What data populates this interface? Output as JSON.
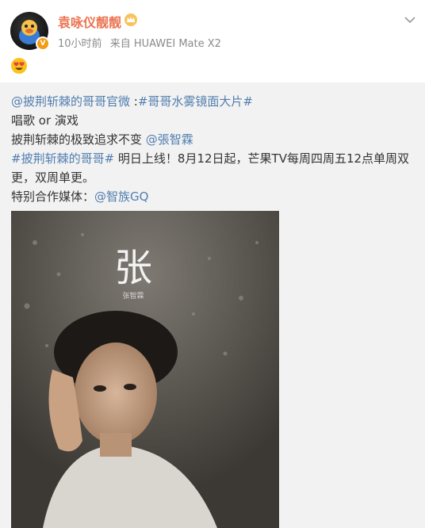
{
  "header": {
    "username": "袁咏仪靓靓",
    "time": "10小时前",
    "source": "来自 HUAWEI Mate X2"
  },
  "post": {
    "line1_mention": "@披荆斩棘的哥哥官微",
    "line1_sep": " :",
    "line1_tag": "#哥哥水雾镜面大片#",
    "line2": "唱歌 or 演戏",
    "line3_text": "披荆斩棘的极致追求不变 ",
    "line3_mention": "@張智霖",
    "line4_tag": "#披荆斩棘的哥哥#",
    "line4_text": " 明日上线！8月12日起，芒果TV每周四周五12点单周双更，双周单更。",
    "line5_text": "特别合作媒体：",
    "line5_mention": "@智族GQ"
  },
  "photo": {
    "title_char": "张",
    "subtitle": "张智霖"
  },
  "colors": {
    "username": "#eb7350",
    "link": "#507daf",
    "meta": "#8a8a8a",
    "body_bg": "#f2f2f2"
  },
  "icons": {
    "vip": "crown-icon",
    "more": "chevron-down-icon",
    "emoji": "heart-eyes-emoji-icon",
    "verify": "verified-badge-icon"
  }
}
